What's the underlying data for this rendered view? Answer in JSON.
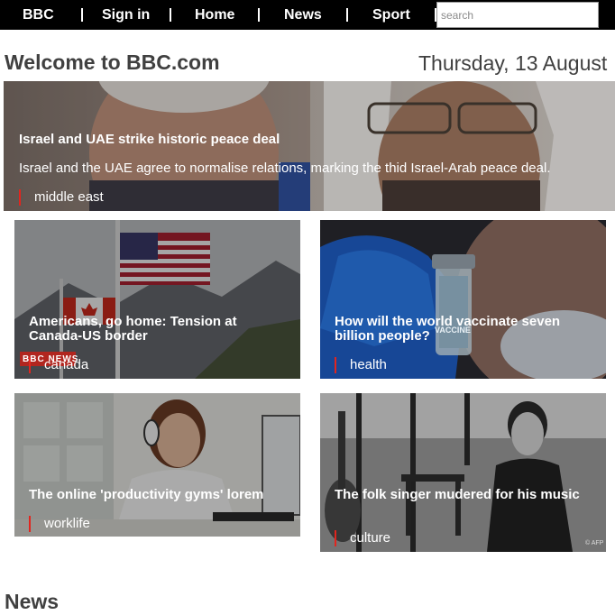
{
  "nav": {
    "items": [
      {
        "label": "BBC"
      },
      {
        "label": "Sign in"
      },
      {
        "label": "Home"
      },
      {
        "label": "News"
      },
      {
        "label": "Sport"
      }
    ],
    "search_placeholder": "search"
  },
  "header": {
    "welcome": "Welcome to BBC.com",
    "date": "Thursday, 13 August"
  },
  "hero": {
    "title": "Israel and UAE strike historic peace deal",
    "description": "Israel and the UAE agree to normalise relations, marking the thid Israel-Arab peace deal.",
    "tag": "middle east"
  },
  "cards": [
    {
      "title": "Americans, go home: Tension at Canada-US border",
      "tag": "canada",
      "watermark": "BBC NEWS"
    },
    {
      "title": "How will the world vaccinate seven billion people?",
      "tag": "health",
      "vial_label": "VACCINE"
    },
    {
      "title": "The online 'productivity gyms' lorem",
      "tag": "worklife"
    },
    {
      "title": "The folk singer mudered for his music",
      "tag": "culture",
      "credit": "© AFP"
    }
  ],
  "sections": {
    "news_title": "News"
  },
  "colors": {
    "nav_bg": "#000000",
    "tag_accent": "#e2251e",
    "heading": "#404040"
  }
}
